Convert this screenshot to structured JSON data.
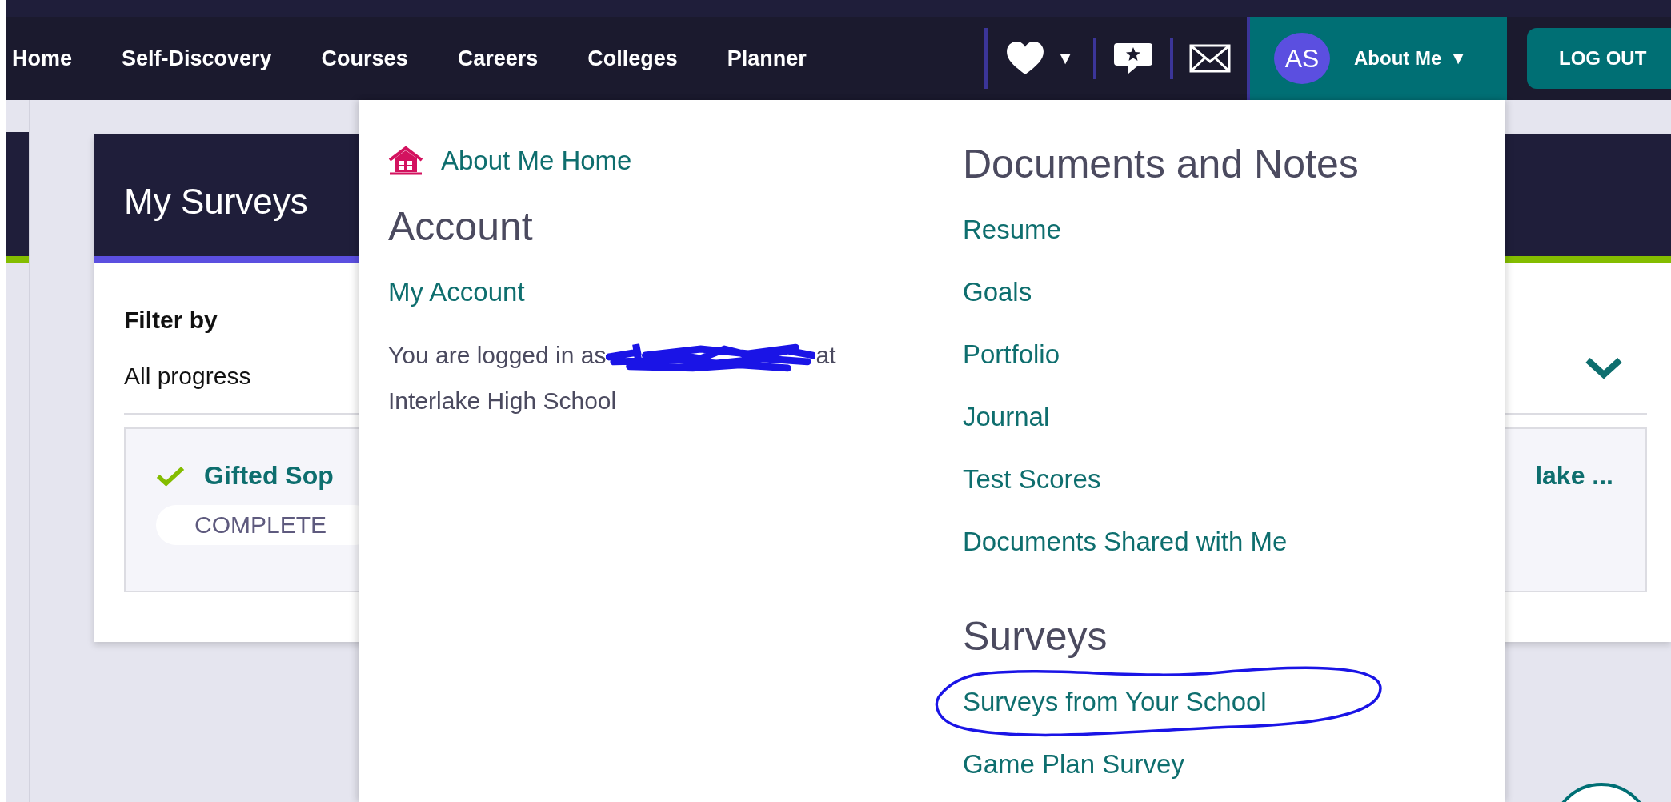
{
  "nav": {
    "items": [
      {
        "label": "Home"
      },
      {
        "label": "Self-Discovery"
      },
      {
        "label": "Courses"
      },
      {
        "label": "Careers"
      },
      {
        "label": "Colleges"
      },
      {
        "label": "Planner"
      }
    ],
    "favorites_caret": "▼",
    "about": {
      "initials": "AS",
      "label": "About Me",
      "caret": "▼",
      "expanded": true
    },
    "logout": "LOG OUT"
  },
  "page": {
    "title": "My Surveys",
    "filter_label": "Filter by",
    "filter_value": "All progress",
    "surveys": [
      {
        "title_start": "Gifted Sop",
        "title_end": "lake ...",
        "completed": true,
        "status": "COMPLETE"
      }
    ]
  },
  "dropdown": {
    "home_link": "About Me Home",
    "columns": [
      [
        {
          "kind": "heading",
          "text": "Account"
        },
        {
          "kind": "link",
          "text": "My Account",
          "circled": false
        },
        {
          "kind": "login_note",
          "prefix": "You are logged in as",
          "redacted": true,
          "suffix": "at",
          "second_line": "Interlake High School"
        }
      ],
      [
        {
          "kind": "heading",
          "text": "Documents and Notes"
        },
        {
          "kind": "link",
          "text": "Resume",
          "circled": false
        },
        {
          "kind": "link",
          "text": "Goals",
          "circled": false
        },
        {
          "kind": "link",
          "text": "Portfolio",
          "circled": false
        },
        {
          "kind": "link",
          "text": "Journal",
          "circled": false
        },
        {
          "kind": "link",
          "text": "Test Scores",
          "circled": false
        },
        {
          "kind": "link",
          "text": "Documents Shared with Me",
          "circled": false
        },
        {
          "kind": "heading",
          "text": "Surveys"
        },
        {
          "kind": "link",
          "text": "Surveys from Your School",
          "circled": true
        },
        {
          "kind": "link",
          "text": "Game Plan Survey",
          "circled": false
        }
      ]
    ]
  }
}
